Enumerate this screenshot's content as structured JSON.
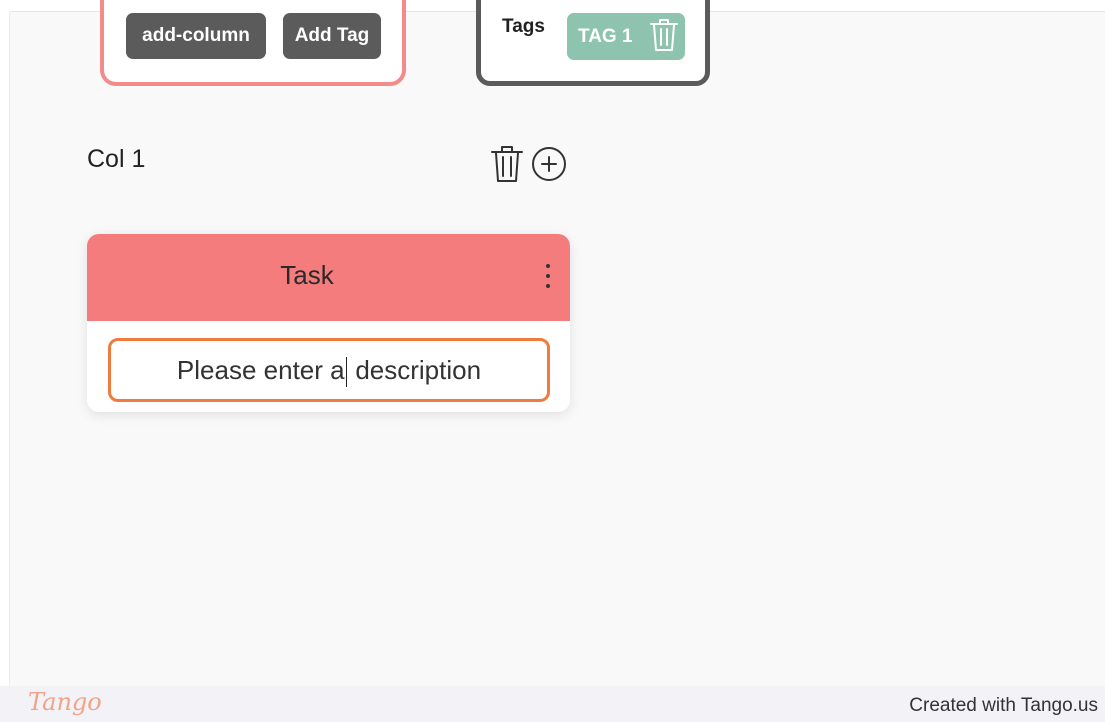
{
  "toolbar": {
    "add_column_label": "add-column",
    "add_tag_label": "Add Tag"
  },
  "tags_panel": {
    "label": "Tags",
    "tags": [
      {
        "label": "TAG 1",
        "color": "#8ec4af"
      }
    ]
  },
  "column": {
    "title": "Col 1",
    "icons": [
      "trash-icon",
      "plus-circle-icon"
    ]
  },
  "task": {
    "title": "Task",
    "header_color": "#f47c7c",
    "description_before_caret": "Please enter a",
    "description_after_caret": " description",
    "focus_color": "#f07b3f"
  },
  "footer": {
    "logo": "Tango",
    "credit": "Created with Tango.us"
  }
}
